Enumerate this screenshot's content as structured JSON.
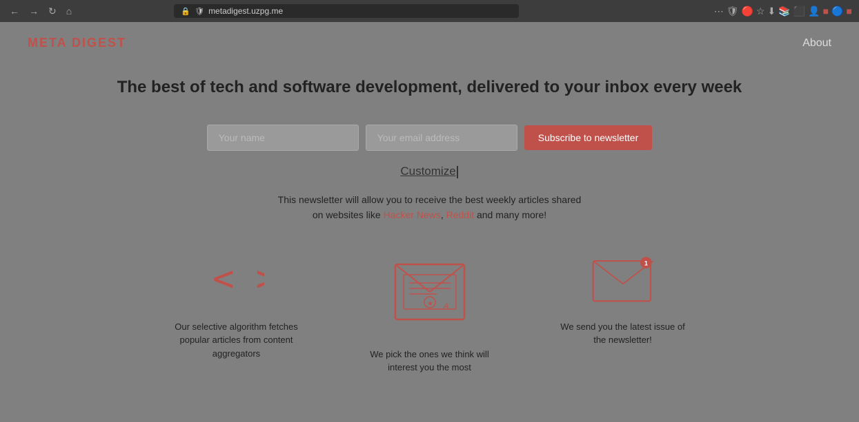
{
  "browser": {
    "url": "metadigest.uzpg.me",
    "more_icon": "⋯",
    "shield_icon": "🛡",
    "bookmark_icon": "☆"
  },
  "nav": {
    "logo": "META DIGEST",
    "about_label": "About"
  },
  "hero": {
    "headline": "The best of tech and software development, delivered to your inbox every week"
  },
  "form": {
    "name_placeholder": "Your name",
    "email_placeholder": "Your email address",
    "subscribe_label": "Subscribe to newsletter"
  },
  "customize": {
    "label": "Customize"
  },
  "description": {
    "text_before": "This newsletter will allow you to receive the best weekly articles shared",
    "text_middle": "on websites like ",
    "hacker_news": "Hacker News",
    "comma": ", ",
    "reddit": "Reddit",
    "text_after": " and many more!"
  },
  "features": [
    {
      "icon": "code",
      "text": "Our selective algorithm fetches popular articles from content aggregators"
    },
    {
      "icon": "newsletter",
      "text": "We pick the ones we think will interest you the most"
    },
    {
      "icon": "envelope",
      "text": "We send you the latest issue of the newsletter!"
    }
  ],
  "colors": {
    "accent": "#c0514a",
    "bg": "#808080",
    "text_dark": "#222222",
    "text_light": "#cccccc"
  }
}
